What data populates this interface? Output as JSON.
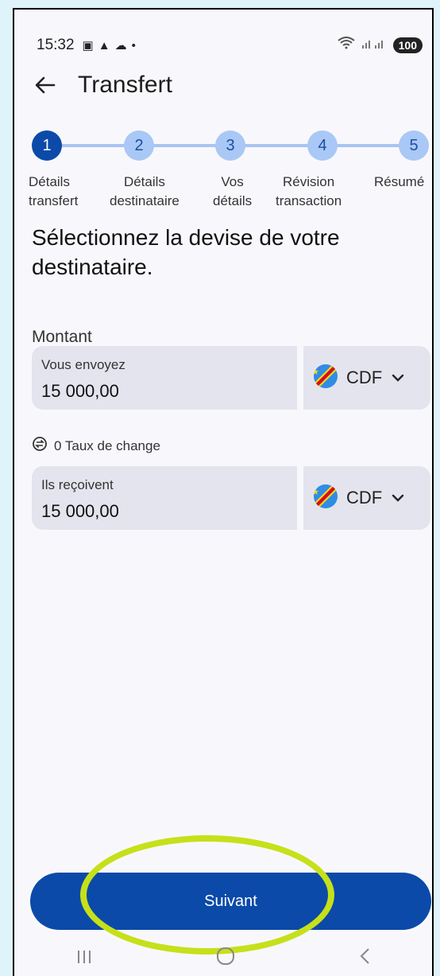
{
  "status_bar": {
    "time": "15:32",
    "battery": "100"
  },
  "app_bar": {
    "title": "Transfert"
  },
  "stepper": {
    "current": 1,
    "steps": [
      {
        "number": "1",
        "label": "Détails\ntransfert"
      },
      {
        "number": "2",
        "label": "Détails\ndestinataire"
      },
      {
        "number": "3",
        "label": "Vos\ndétails"
      },
      {
        "number": "4",
        "label": "Révision\ntransaction"
      },
      {
        "number": "5",
        "label": "Résumé"
      }
    ]
  },
  "heading": "Sélectionnez la devise de votre destinataire.",
  "amount": {
    "section_label": "Montant",
    "send": {
      "label": "Vous envoyez",
      "value": "15 000,00",
      "currency": "CDF"
    },
    "rate": "0 Taux de change",
    "receive": {
      "label": "Ils reçoivent",
      "value": "15 000,00",
      "currency": "CDF"
    }
  },
  "next_button": "Suivant",
  "colors": {
    "primary": "#0b4aa8",
    "highlight": "#c6e01a",
    "step_inactive": "#a9c8f6"
  }
}
